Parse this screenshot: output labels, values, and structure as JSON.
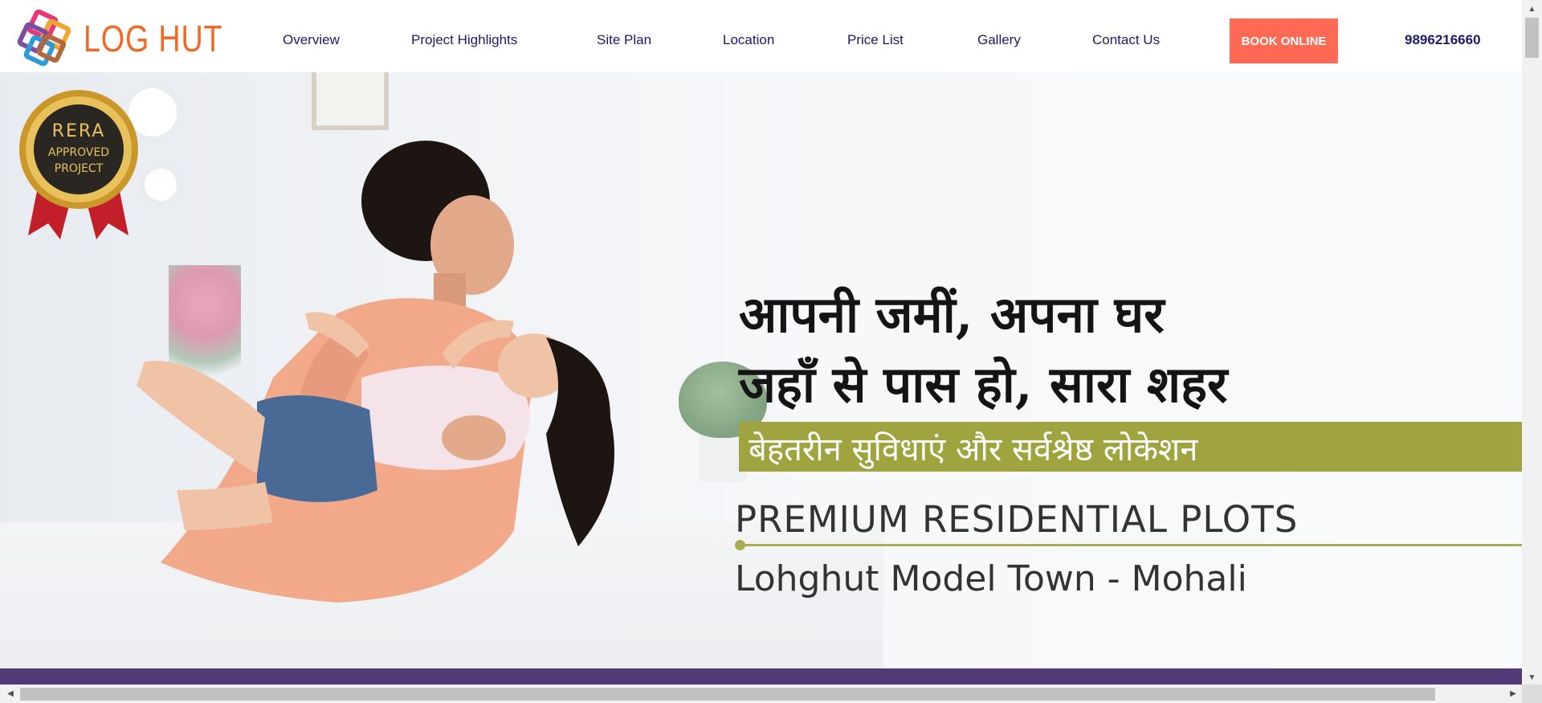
{
  "header": {
    "logo_text": "LOG HUT",
    "nav": [
      {
        "label": "Overview"
      },
      {
        "label": "Project Highlights"
      },
      {
        "label": "Site Plan"
      },
      {
        "label": "Location"
      },
      {
        "label": "Price List"
      },
      {
        "label": "Gallery"
      },
      {
        "label": "Contact Us"
      }
    ],
    "book_button": "BOOK ONLINE",
    "phone": "9896216660"
  },
  "hero": {
    "badge": {
      "line1": "RERA",
      "line2": "APPROVED",
      "line3": "PROJECT"
    },
    "headline_line1": "आपनी जमीं, अपना घर",
    "headline_line2": "जहाँ से पास हो, सारा शहर",
    "tagline": "बेहतरीन सुविधाएं और सर्वश्रेष्ठ लोकेशन",
    "title": "PREMIUM RESIDENTIAL PLOTS",
    "location": "Lohghut Model Town - Mohali"
  },
  "colors": {
    "logo": "#f06a25",
    "nav_text": "#1a1a6e",
    "book_button_bg": "#ff6a55",
    "tagline_band": "#9fa43f",
    "footer_band": "#523a78"
  },
  "icons": {
    "logo_mark": "interlocking-squares-logo-icon",
    "scroll_up": "triangle-up-icon",
    "scroll_down": "triangle-down-icon",
    "scroll_left": "triangle-left-icon",
    "scroll_right": "triangle-right-icon"
  }
}
